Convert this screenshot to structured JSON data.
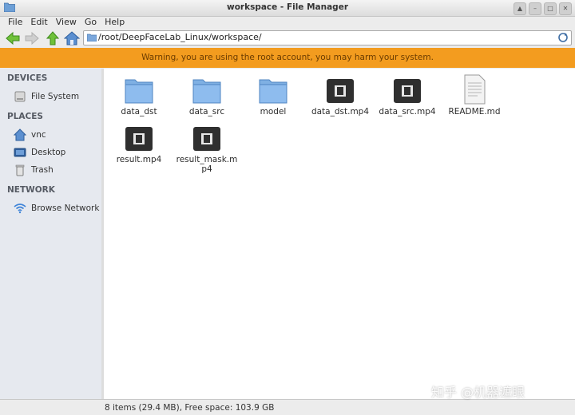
{
  "window": {
    "title": "workspace - File Manager"
  },
  "window_controls": [
    "up-arrow-icon",
    "minimize-icon",
    "maximize-icon",
    "close-icon"
  ],
  "menubar": {
    "items": [
      "File",
      "Edit",
      "View",
      "Go",
      "Help"
    ]
  },
  "toolbar": {
    "buttons": [
      "back-arrow-icon",
      "forward-arrow-icon",
      "up-arrow-icon",
      "home-icon"
    ],
    "location": "/root/DeepFaceLab_Linux/workspace/"
  },
  "warning": {
    "text": "Warning, you are using the root account, you may harm your system.",
    "color": "#f39c1f"
  },
  "sidebar": {
    "devices_header": "DEVICES",
    "places_header": "PLACES",
    "network_header": "NETWORK",
    "devices": [
      {
        "label": "File System",
        "icon": "drive-icon"
      }
    ],
    "places": [
      {
        "label": "vnc",
        "icon": "home-folder-icon"
      },
      {
        "label": "Desktop",
        "icon": "desktop-icon"
      },
      {
        "label": "Trash",
        "icon": "trash-icon"
      }
    ],
    "network": [
      {
        "label": "Browse Network",
        "icon": "wifi-icon"
      }
    ]
  },
  "files": [
    {
      "name": "data_dst",
      "type": "folder"
    },
    {
      "name": "data_src",
      "type": "folder"
    },
    {
      "name": "model",
      "type": "folder"
    },
    {
      "name": "data_dst.mp4",
      "type": "video"
    },
    {
      "name": "data_src.mp4",
      "type": "video"
    },
    {
      "name": "README.md",
      "type": "text"
    },
    {
      "name": "result.mp4",
      "type": "video"
    },
    {
      "name": "result_mask.mp4",
      "type": "video"
    }
  ],
  "status": {
    "text": "8 items (29.4 MB), Free space: 103.9 GB"
  },
  "watermark": {
    "text": "知乎 @机器遮眼"
  }
}
